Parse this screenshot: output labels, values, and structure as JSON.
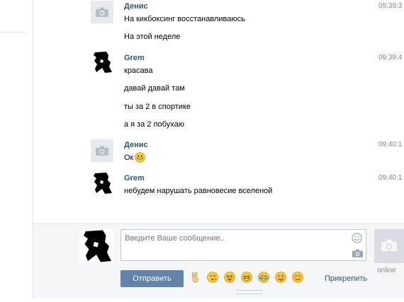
{
  "messages": [
    {
      "author": "Денис",
      "avatar": "camera-placeholder",
      "time": "09:39:3",
      "lines": [
        "На кикбоксинг восстанавливаюсь",
        "На этой неделе"
      ]
    },
    {
      "author": "Grem",
      "avatar": "grem-silhouette",
      "time": "09:39:4",
      "lines": [
        "красава",
        "давай давай там",
        "ты за 2 в спортике",
        "а я за 2 побухаю"
      ]
    },
    {
      "author": "Денис",
      "avatar": "camera-placeholder",
      "time": "09:40:1",
      "lines": [
        "Ок"
      ]
    },
    {
      "author": "Grem",
      "avatar": "grem-silhouette",
      "time": "09:40:1",
      "lines": [
        "небудем нарушать равновесие вселеной"
      ]
    }
  ],
  "composer": {
    "placeholder": "Введите Ваше сообщение..",
    "send_label": "Отправить",
    "attach_label": "Прикрепить",
    "status_label": "online",
    "emojis": [
      "victory-hand-emoji",
      "kiss-emoji",
      "tongue-wink-emoji",
      "laughing-emoji",
      "tears-of-joy-emoji",
      "wink-tongue-emoji",
      "blush-emoji"
    ]
  },
  "colors": {
    "author_link": "#2b587a",
    "send_button": "#6383a8",
    "composer_bg": "#f4f6f8"
  }
}
